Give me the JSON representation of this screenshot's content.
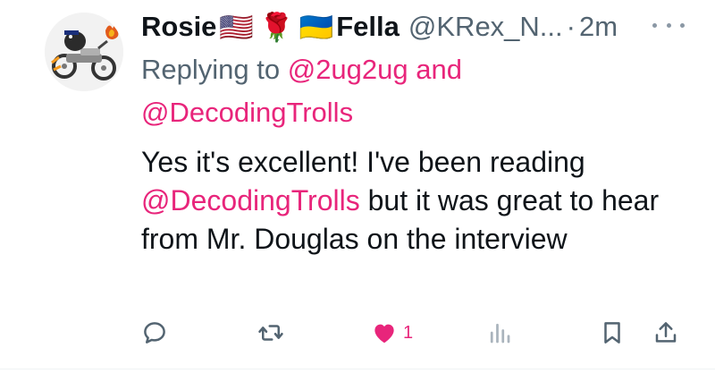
{
  "tweet": {
    "display_name": "Rosie",
    "display_name_suffix": "Fella",
    "name_emojis": [
      "🇺🇸",
      "🌹",
      "🇺🇦"
    ],
    "handle": "@KRex_N...",
    "separator": "·",
    "time": "2m",
    "replying_to_prefix": "Replying to",
    "reply_mention_1": "@2ug2ug",
    "reply_and": "and",
    "reply_mention_2": "@DecodingTrolls",
    "text_part1": "Yes it's excellent! I've been reading",
    "text_mention": "@DecodingTrolls",
    "text_part2": "but it was great to hear from Mr. Douglas on the interview"
  },
  "actions": {
    "like_count": "1"
  },
  "icons": {
    "reply": "reply-icon",
    "retweet": "retweet-icon",
    "like": "heart-icon",
    "views": "views-icon",
    "bookmark": "bookmark-icon",
    "share": "share-icon",
    "more": "more-icon"
  },
  "colors": {
    "accent_pink": "#e8257b",
    "secondary_text": "#536471",
    "primary_text": "#0f1419"
  }
}
